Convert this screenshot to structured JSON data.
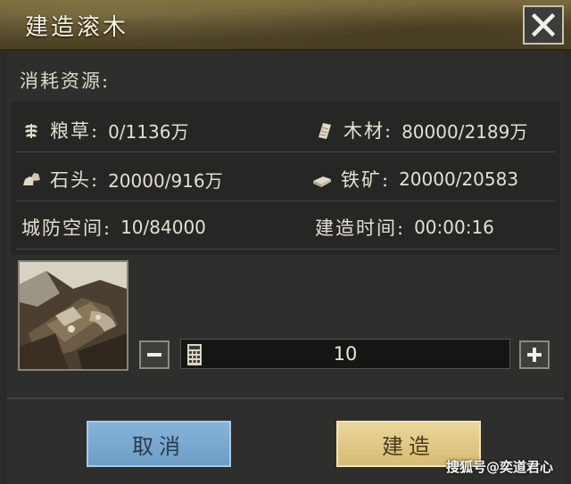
{
  "dialog": {
    "title": "建造滚木",
    "consume_label": "消耗资源:"
  },
  "resources": {
    "grain": {
      "label": "粮草:",
      "value": "0/1136万",
      "icon": "wheat-icon"
    },
    "wood": {
      "label": "木材:",
      "value": "80000/2189万",
      "icon": "wood-icon"
    },
    "stone": {
      "label": "石头:",
      "value": "20000/916万",
      "icon": "stone-icon"
    },
    "iron": {
      "label": "铁矿:",
      "value": "20000/20583",
      "icon": "iron-ore-icon"
    },
    "defense_space": {
      "label": "城防空间:",
      "value": "10/84000"
    },
    "build_time": {
      "label": "建造时间:",
      "value": "00:00:16"
    }
  },
  "quantity": {
    "value": "10"
  },
  "buttons": {
    "cancel": "取消",
    "build": "建造"
  },
  "watermark": "搜狐号@奕道君心",
  "colors": {
    "cancel_button": "#7ba9d0",
    "build_button": "#e0c886",
    "title_bar": "#5d502c"
  }
}
